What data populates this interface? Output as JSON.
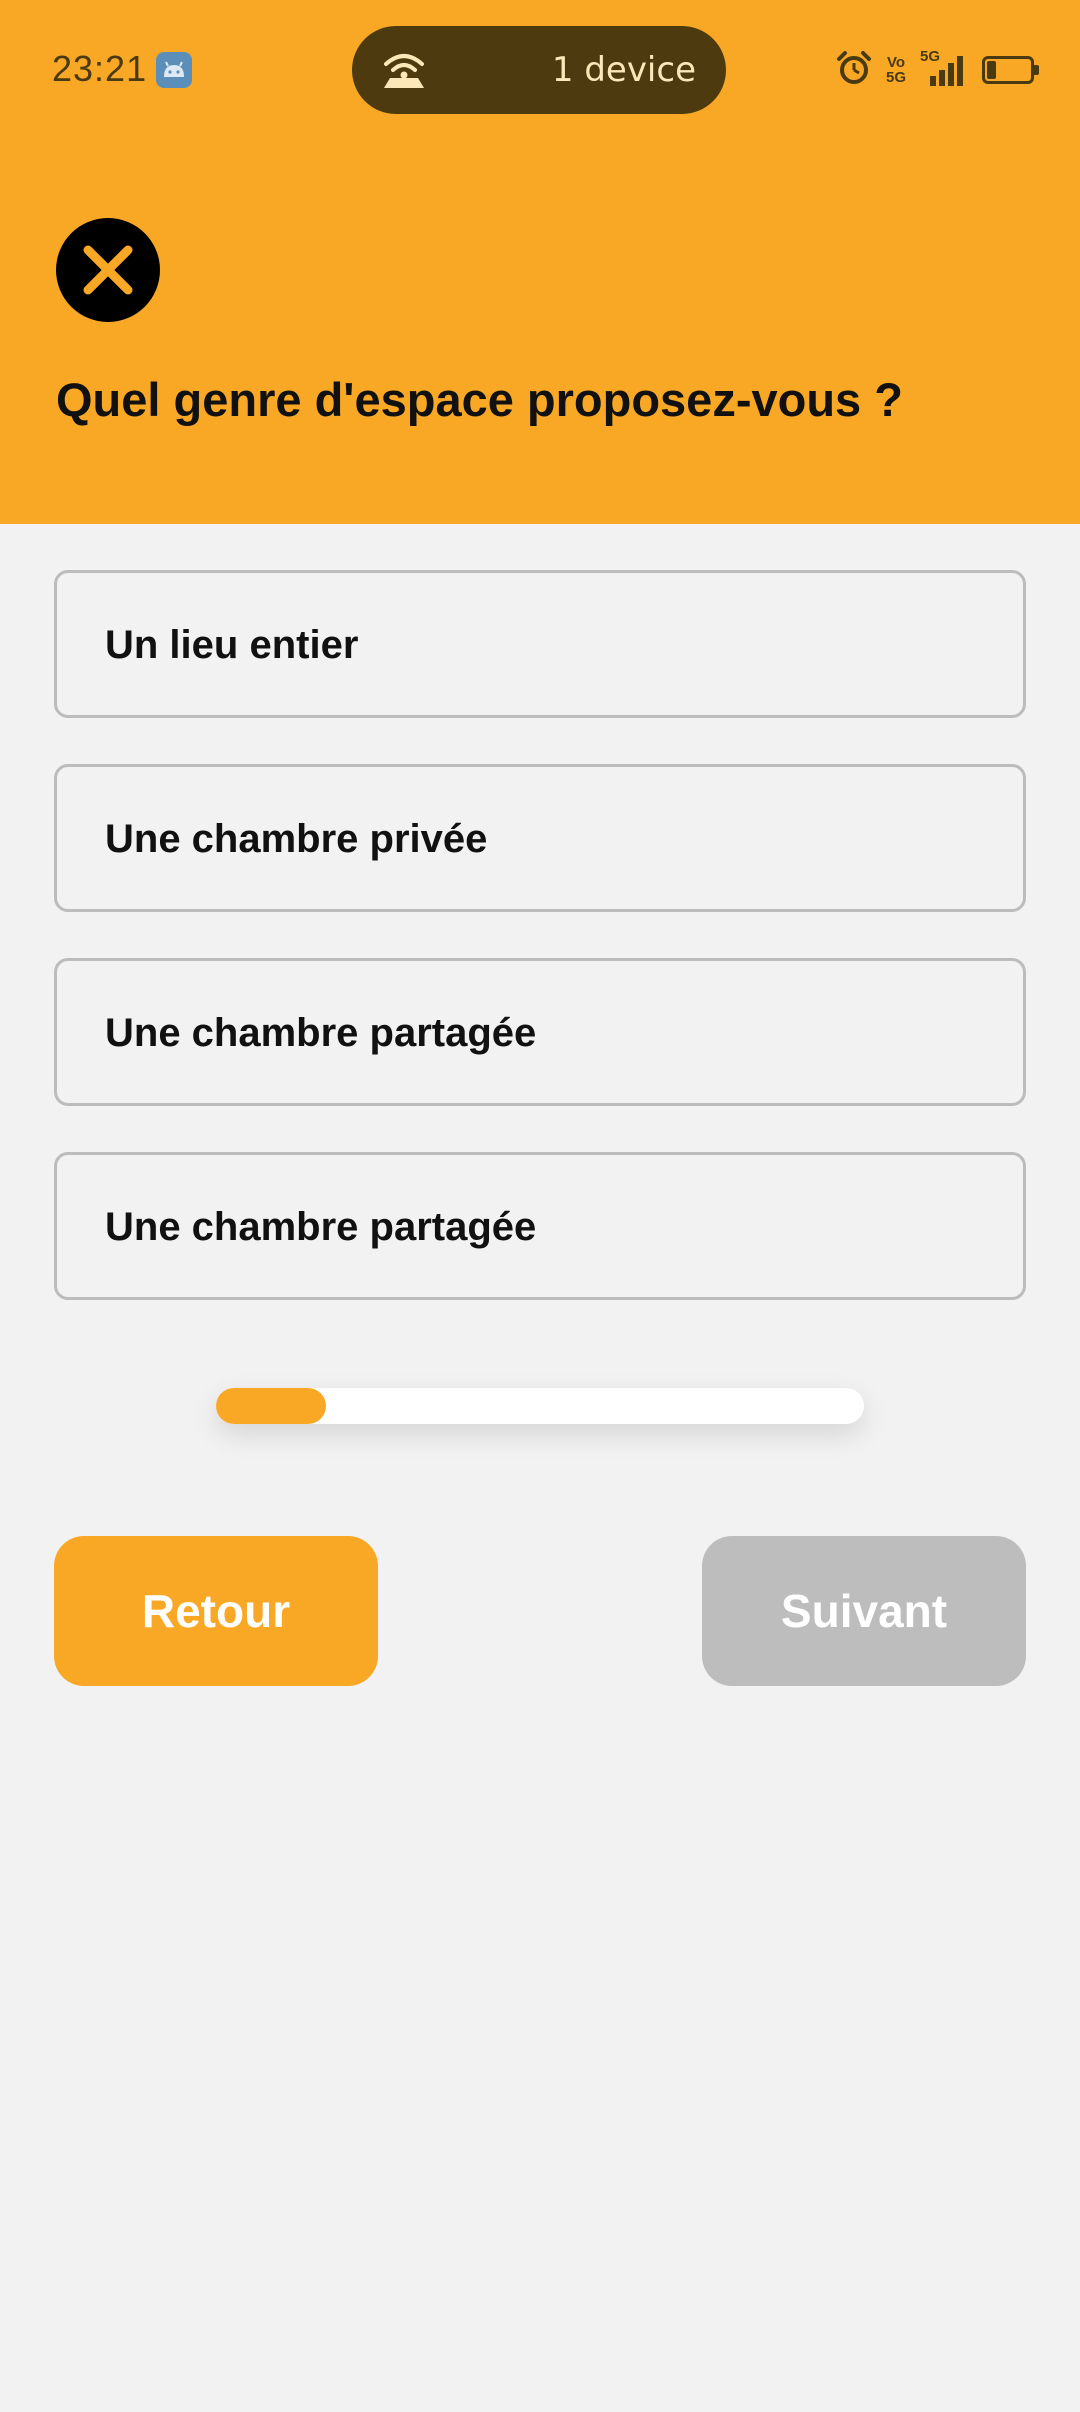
{
  "status_bar": {
    "time": "23:21",
    "hotspot_text": "1 device",
    "volte_line1": "Vo",
    "volte_line2": "5G",
    "network": "5G",
    "battery_level": "22",
    "battery_percent": 22
  },
  "header": {
    "title": "Quel genre d'espace proposez-vous ?",
    "color": "#f9a826"
  },
  "options": [
    {
      "label": "Un lieu entier"
    },
    {
      "label": "Une chambre privée"
    },
    {
      "label": "Une chambre partagée"
    },
    {
      "label": "Une chambre partagée"
    }
  ],
  "progress": {
    "fraction": 0.17
  },
  "buttons": {
    "back_label": "Retour",
    "next_label": "Suivant"
  },
  "icons": {
    "close": "close-icon",
    "app": "android-icon",
    "hotspot": "hotspot-icon",
    "alarm": "alarm-icon",
    "signal": "signal-icon",
    "battery": "battery-icon"
  },
  "colors": {
    "accent": "#f9a826",
    "disabled": "#bdbdbd",
    "background": "#f2f2f2"
  }
}
